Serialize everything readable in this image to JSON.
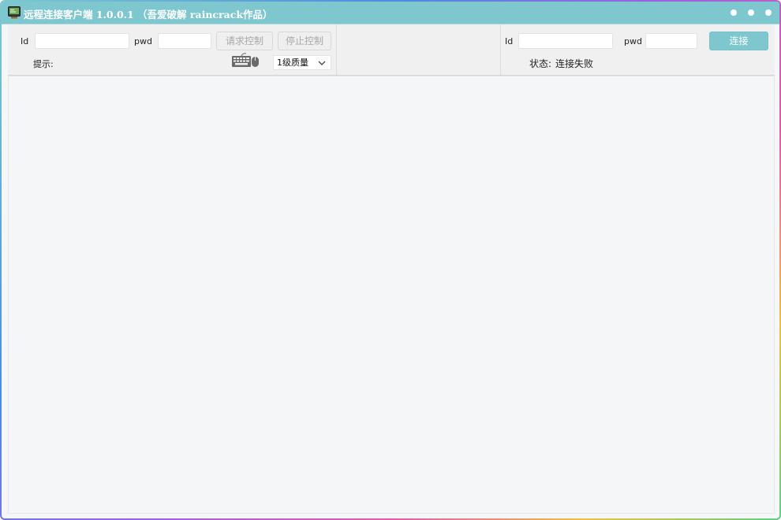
{
  "window": {
    "title": "远程连接客户端 1.0.0.1 （吾爱破解 raincrack作品）",
    "app_icon": "terminal-icon",
    "controls": [
      "minimize-dot",
      "maximize-dot",
      "close-dot"
    ]
  },
  "colors": {
    "accent": "#7fc7cf",
    "background": "#f5f6f8",
    "toolbar": "#f0f0f0"
  },
  "controller": {
    "id_label": "Id",
    "id_value": "",
    "pwd_label": "pwd",
    "pwd_value": "",
    "request_control_label": "请求控制",
    "stop_control_label": "停止控制",
    "hint_label": "提示:",
    "keyboard_icon": "keyboard-mouse-icon",
    "quality_selected": "1级质量"
  },
  "connection": {
    "id_label": "Id",
    "id_value": "",
    "pwd_label": "pwd",
    "pwd_value": "",
    "connect_label": "连接",
    "status_label": "状态:",
    "status_value": "连接失败"
  }
}
